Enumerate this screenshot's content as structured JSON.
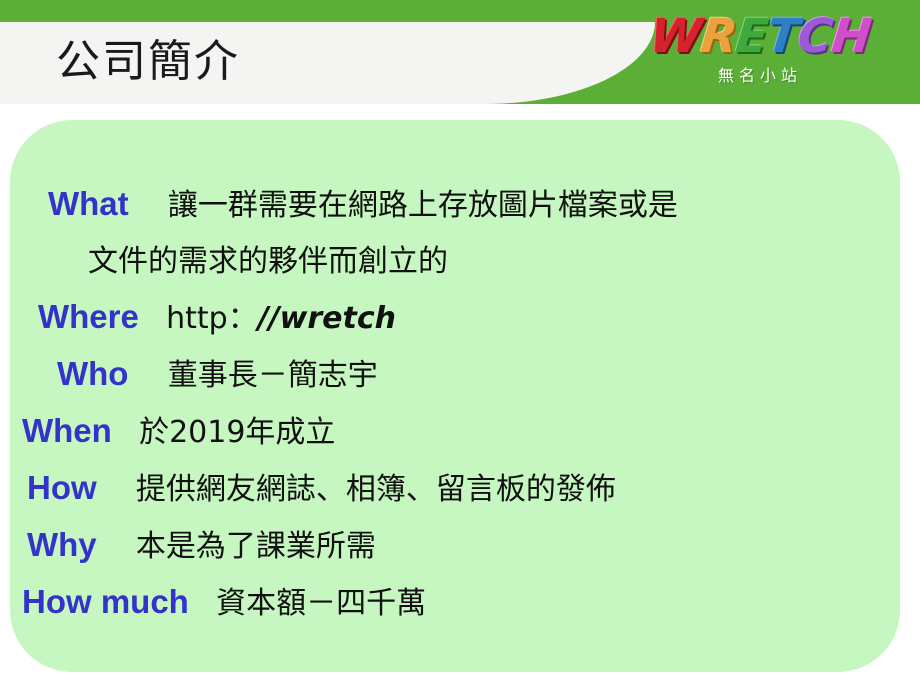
{
  "header": {
    "title": "公司簡介",
    "background_color": "#5BAF37",
    "banner_color": "#F4F4F2"
  },
  "logo": {
    "letters": [
      "W",
      "R",
      "E",
      "T",
      "C",
      "H"
    ],
    "wordmark": "WRETCH",
    "subtitle": "無名小站",
    "letter_colors": [
      "#D6232B",
      "#E8A33D",
      "#3FA93C",
      "#2E7FC4",
      "#9A5BD4",
      "#CE4FC8"
    ]
  },
  "content": {
    "background_color": "#C6F7C0",
    "keyword_color": "#3333CC",
    "body_color": "#111111",
    "lines": [
      {
        "keyword": "What",
        "text": "讓一群需要在網路上存放圖片檔案或是",
        "continuation": "文件的需求的夥伴而創立的"
      },
      {
        "keyword": "Where",
        "text_prefix": "http：",
        "text_url": "//wretch"
      },
      {
        "keyword": "Who",
        "text": "董事長－簡志宇"
      },
      {
        "keyword": "When",
        "text": "於2019年成立"
      },
      {
        "keyword": "How",
        "text": "提供網友網誌、相簿、留言板的發佈"
      },
      {
        "keyword": "Why",
        "text": "本是為了課業所需"
      },
      {
        "keyword": "How much",
        "text": "資本額－四千萬"
      }
    ]
  }
}
